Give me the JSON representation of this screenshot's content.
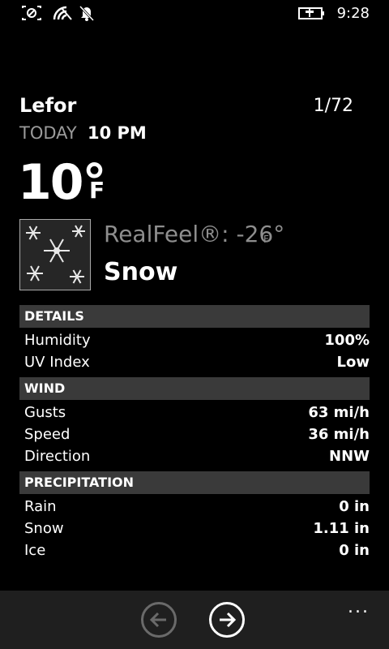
{
  "status": {
    "time": "9:28"
  },
  "header": {
    "location": "Lefor",
    "counter": "1/72",
    "today": "TODAY",
    "hour": "10 PM"
  },
  "current": {
    "temperature": "10°",
    "temperature_unit": "F",
    "realfeel": "RealFeel®: -26°",
    "realfeel_unit": "F",
    "condition": "Snow"
  },
  "sections": {
    "details": {
      "title": "DETAILS",
      "rows": [
        {
          "label": "Humidity",
          "value": "100%"
        },
        {
          "label": "UV Index",
          "value": "Low"
        }
      ]
    },
    "wind": {
      "title": "WIND",
      "rows": [
        {
          "label": "Gusts",
          "value": "63 mi/h"
        },
        {
          "label": "Speed",
          "value": "36 mi/h"
        },
        {
          "label": "Direction",
          "value": "NNW"
        }
      ]
    },
    "precipitation": {
      "title": "PRECIPITATION",
      "rows": [
        {
          "label": "Rain",
          "value": "0 in"
        },
        {
          "label": "Snow",
          "value": "1.11 in"
        },
        {
          "label": "Ice",
          "value": "0 in"
        }
      ]
    }
  },
  "appbar": {
    "more": "..."
  },
  "icons": [
    "screen-capture-icon",
    "wifi-icon",
    "quiet-hours-icon",
    "battery-charging-icon",
    "snowflake-image",
    "back-arrow-icon",
    "forward-arrow-icon",
    "more-icon"
  ],
  "colors": {
    "background": "#000000",
    "secondary_text": "#9b9b9b",
    "section_header": "#3a3a3a",
    "appbar": "#1f1f1f"
  }
}
